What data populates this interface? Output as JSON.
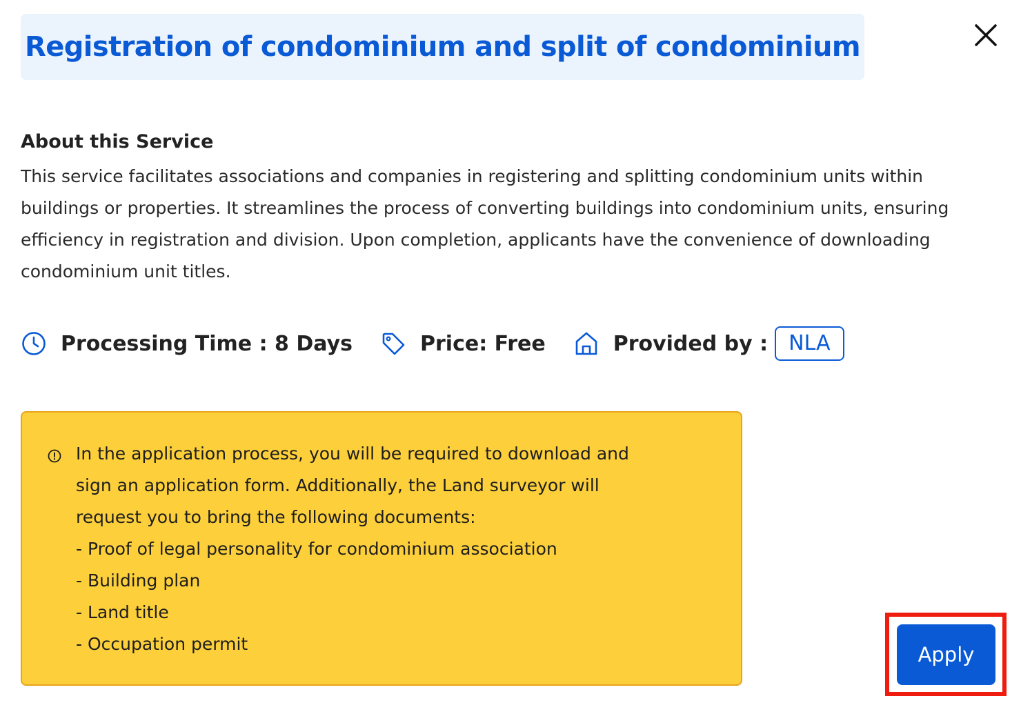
{
  "dialog": {
    "title": "Registration of condominium and split of condominium",
    "close_icon": "close-icon"
  },
  "about": {
    "heading": "About this Service",
    "description": "This service facilitates associations and companies in registering and splitting condominium units within buildings or properties. It streamlines the process of converting buildings into condominium units, ensuring efficiency in registration and division. Upon completion, applicants have the convenience of downloading condominium unit titles."
  },
  "meta": {
    "processing_time": {
      "icon": "clock-icon",
      "text": "Processing Time : 8 Days"
    },
    "price": {
      "icon": "price-tag-icon",
      "text": "Price: Free"
    },
    "provider": {
      "icon": "home-icon",
      "label": "Provided by :",
      "badge": "NLA"
    }
  },
  "notice": {
    "icon": "info-circle-icon",
    "lines": [
      "In the application process, you will be required to download and",
      "sign an application form. Additionally, the Land surveyor will",
      "request you to bring the following documents:",
      "- Proof of legal personality for condominium association",
      "- Building plan",
      "- Land title",
      "- Occupation permit"
    ]
  },
  "actions": {
    "apply_label": "Apply"
  },
  "colors": {
    "accent": "#0a5ad6",
    "title_bg": "#ebf3fd",
    "notice_bg": "#fdd03b",
    "notice_border": "#e8a41c",
    "highlight": "#ee1d0f"
  }
}
